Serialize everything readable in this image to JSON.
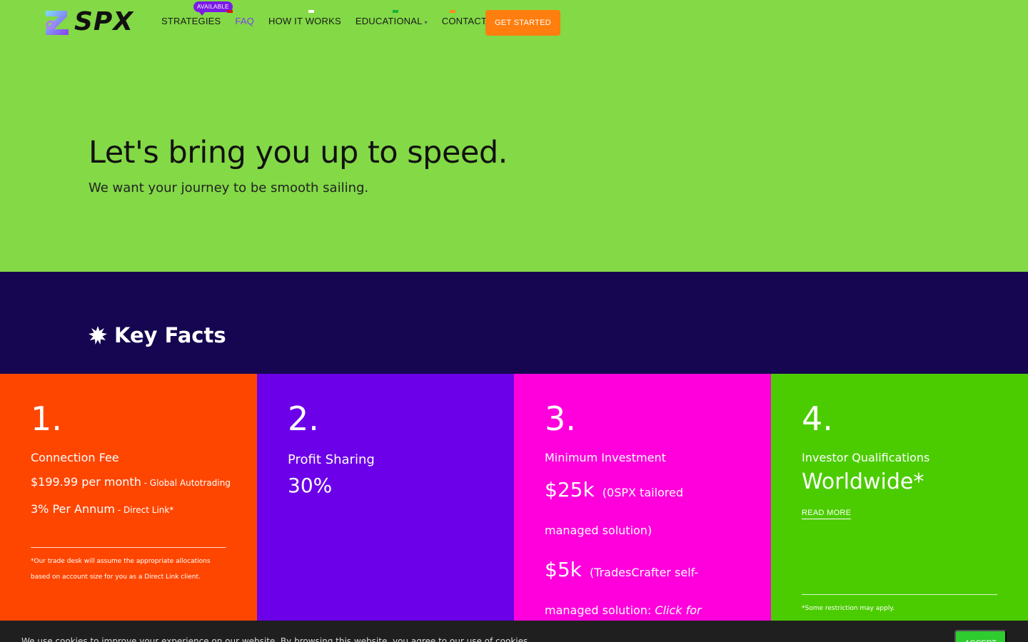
{
  "header": {
    "logo_text": "SPX",
    "badge": "AVAILABLE",
    "nav": [
      {
        "label": "STRATEGIES"
      },
      {
        "label": "FAQ"
      },
      {
        "label": "HOW IT WORKS"
      },
      {
        "label": "EDUCATIONAL"
      },
      {
        "label": "CONTACT"
      }
    ],
    "cta": "GET STARTED"
  },
  "hero": {
    "title": "Let's bring you up to speed.",
    "subtitle": "We want your journey to be smooth sailing."
  },
  "facts": {
    "title": "Key Facts",
    "cards": [
      {
        "num": "1.",
        "label": "Connection Fee",
        "line1_big": "$199.99 per month",
        "line1_small": " - Global Autotrading",
        "line2_big": "3% Per Annum",
        "line2_small": " - Direct Link*",
        "note": "*Our trade desk will assume the appropriate allocations based on account size for you as a Direct Link client."
      },
      {
        "num": "2.",
        "label": "Profit Sharing",
        "value": "30%"
      },
      {
        "num": "3.",
        "label": "Minimum Investment",
        "v1": "$25k",
        "v1_note": "(0SPX tailored",
        "v1_note2": "managed solution)",
        "v2": "$5k",
        "v2_note": "(TradesCrafter self-",
        "v2_note2": "managed solution: ",
        "v2_link": "Click for"
      },
      {
        "num": "4.",
        "label": "Investor Qualifications",
        "value": "Worldwide*",
        "read_more": "READ MORE",
        "note": "*Some restriction may apply."
      }
    ]
  },
  "cookie": {
    "text": "We use cookies to improve your experience on our website. By browsing this website, you agree to our use of cookies.",
    "accept": "ACCEPT"
  },
  "colors": {
    "background": "#83d946",
    "facts_band": "#160550",
    "card1": "#ff4600",
    "card2": "#6c00e8",
    "card3": "#ff00dd",
    "card4": "#4bcc00",
    "cta": "#ff7e0e",
    "nav_active": "#7d3ef0"
  }
}
